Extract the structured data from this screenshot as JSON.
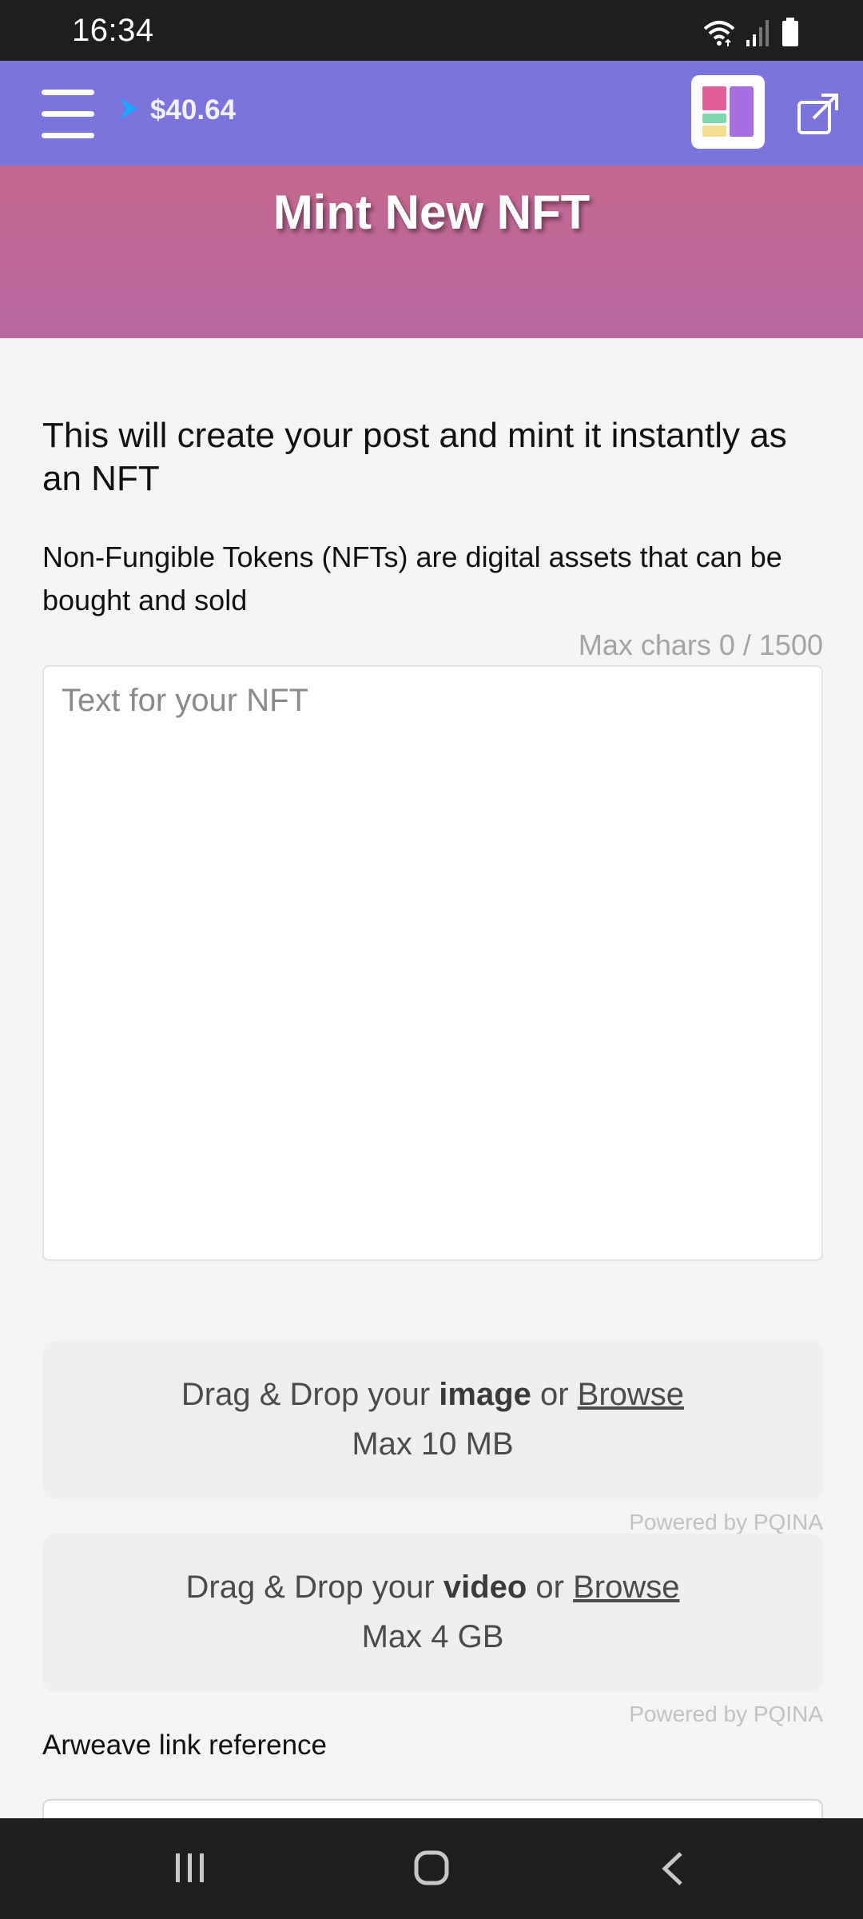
{
  "status_bar": {
    "time": "16:34",
    "icons": [
      "wifi-icon",
      "signal-icon",
      "battery-icon"
    ]
  },
  "nav": {
    "menu_icon": "hamburger-menu-icon",
    "balance_icon": "chevron-right-icon",
    "balance": "$40.64",
    "app_switch_icon": "layout-grid-icon",
    "external_icon": "external-link-icon"
  },
  "hero": {
    "title": "Mint New NFT"
  },
  "form": {
    "headline": "This will create your post and mint it instantly as an NFT",
    "description": "Non-Fungible Tokens (NFTs) are digital assets that can be bought and sold",
    "char_counter": "Max chars 0 / 1500",
    "text_placeholder": "Text for your NFT",
    "image_drop": {
      "prefix": "Drag & Drop your ",
      "kind": "image",
      "middle": " or ",
      "browse": "Browse",
      "limit": "Max 10 MB",
      "powered_by": "Powered by PQINA"
    },
    "video_drop": {
      "prefix": "Drag & Drop your ",
      "kind": "video",
      "middle": " or ",
      "browse": "Browse",
      "limit": "Max 4 GB",
      "powered_by": "Powered by PQINA"
    },
    "arweave_label": "Arweave link reference",
    "arweave_value": ""
  },
  "system_nav": {
    "icons": [
      "recent-apps-icon",
      "home-icon",
      "back-icon"
    ]
  },
  "colors": {
    "nav_bg": "#7b74dd",
    "hero_top": "#c5678f",
    "hero_bottom": "#b96aa2",
    "page_bg": "#f4f4f4",
    "balance_arrow": "#1ea7ff"
  }
}
